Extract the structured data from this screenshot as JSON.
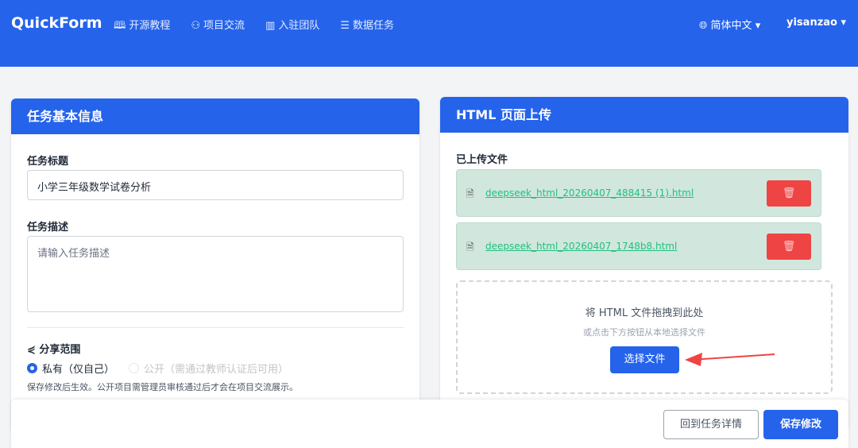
{
  "nav": {
    "logo": "QuickForm",
    "items": [
      {
        "icon": "book-icon",
        "label": "开源教程"
      },
      {
        "icon": "users-icon",
        "label": "项目交流"
      },
      {
        "icon": "building-icon",
        "label": "入驻团队"
      },
      {
        "icon": "database-icon",
        "label": "数据任务"
      }
    ],
    "language": "简体中文",
    "user": "yisanzao"
  },
  "left": {
    "title": "任务基本信息",
    "task_title_label": "任务标题",
    "task_title_value": "小学三年级数学试卷分析",
    "desc_label": "任务描述",
    "desc_placeholder": "请输入任务描述",
    "share_label": "分享范围",
    "private_label": "私有（仅自己）",
    "public_label": "公开（需通过教师认证后可用）",
    "hint": "保存修改后生效。公开项目需管理员审核通过后才会在项目交流展示。"
  },
  "right": {
    "title": "HTML 页面上传",
    "uploaded_label": "已上传文件",
    "files": [
      "deepseek_html_20260407_488415 (1).html",
      "deepseek_html_20260407_1748b8.html"
    ],
    "drop_title": "将 HTML 文件拖拽到此处",
    "drop_sub": "或点击下方按钮从本地选择文件",
    "choose_button": "选择文件"
  },
  "footer": {
    "back_button": "回到任务详情",
    "save_button": "保存修改"
  },
  "colors": {
    "primary": "#2563eb",
    "danger": "#ef4444",
    "success_bg": "#d1e7dd"
  }
}
